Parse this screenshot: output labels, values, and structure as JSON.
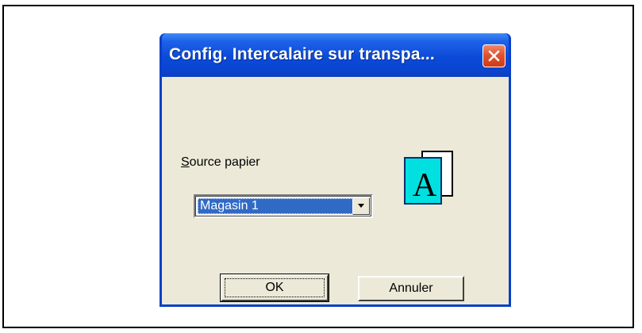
{
  "dialog": {
    "title": "Config. Intercalaire sur transpa...",
    "close_icon": "close-icon",
    "accent_color": "#0a44d0",
    "close_color": "#e0532e"
  },
  "source": {
    "label_accel": "S",
    "label_rest": "ource papier",
    "selected_value": "Magasin 1",
    "dropdown_icon": "chevron-down-icon"
  },
  "preview": {
    "icon": "paper-preview-icon",
    "glyph": "A",
    "color": "#00e0e0"
  },
  "buttons": {
    "ok_label": "OK",
    "cancel_label": "Annuler"
  }
}
